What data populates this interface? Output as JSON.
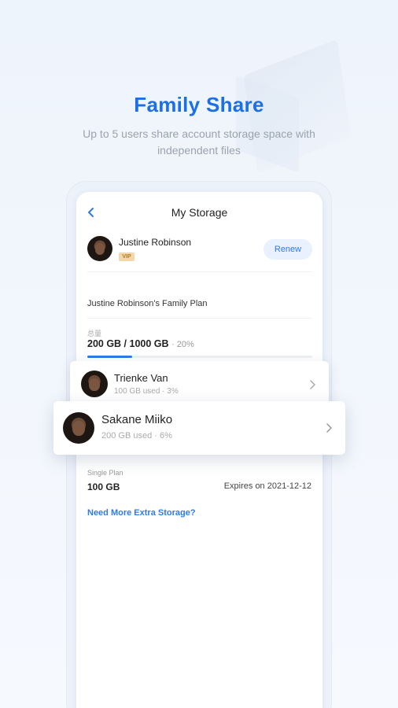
{
  "hero": {
    "title": "Family Share",
    "subtitle": "Up to 5 users share account storage space with independent files"
  },
  "screen": {
    "nav_title": "My Storage",
    "user": {
      "name": "Justine Robinson",
      "badge": "VIP",
      "renew_label": "Renew"
    },
    "family_plan": {
      "title": "Justine Robinson's Family Plan",
      "total_label": "总量",
      "used": "200 GB / 1000 GB",
      "percent_text": "· 20%",
      "progress": 0.2
    },
    "members": [
      {
        "name": "Trienke Van",
        "meta": "100 GB used · 3%"
      },
      {
        "name": "Sakane Miiko",
        "meta": "200 GB used · 6%"
      }
    ],
    "single_plan": {
      "label": "Single Plan",
      "size": "100 GB",
      "expires": "Expires on 2021-12-12"
    },
    "extra_link": "Need More Extra Storage?"
  },
  "colors": {
    "accent": "#1d6fe6",
    "link": "#2f7ae5",
    "vip_bg": "#f3d7a8"
  }
}
